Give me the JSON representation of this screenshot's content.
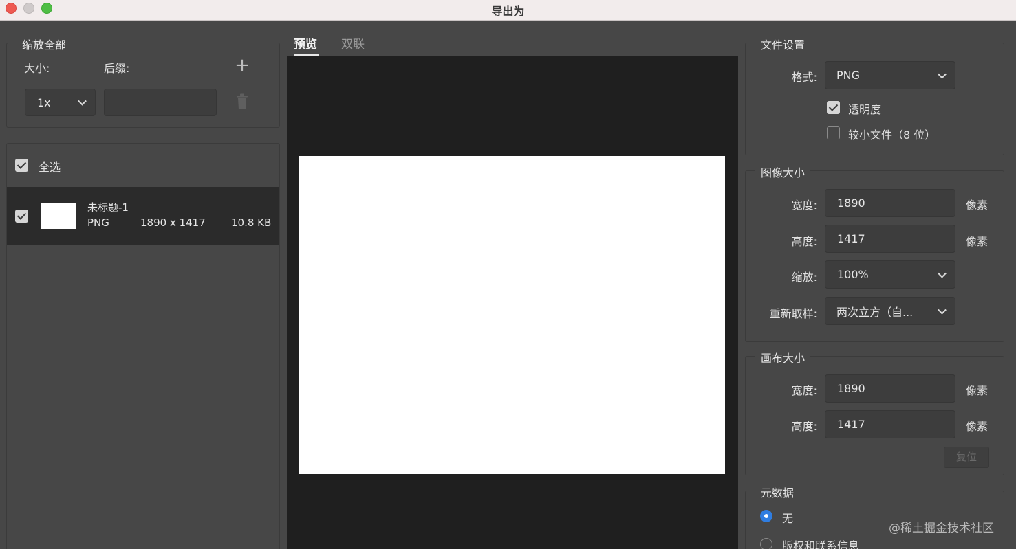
{
  "window": {
    "title": "导出为"
  },
  "scale_all": {
    "legend": "缩放全部",
    "size_label": "大小:",
    "suffix_label": "后缀:",
    "size_value": "1x",
    "suffix_value": "",
    "add_glyph": "+",
    "delete_glyph": "🗑"
  },
  "asset_list": {
    "select_all_label": "全选",
    "select_all_checked": true,
    "items": [
      {
        "name": "未标题-1",
        "format": "PNG",
        "dimensions": "1890 x 1417",
        "size": "10.8 KB",
        "checked": true
      }
    ]
  },
  "preview": {
    "tabs": [
      {
        "label": "预览",
        "active": true
      },
      {
        "label": "双联",
        "active": false
      }
    ],
    "canvas_color": "#ffffff"
  },
  "file_settings": {
    "legend": "文件设置",
    "format_label": "格式:",
    "format_value": "PNG",
    "transparency_label": "透明度",
    "transparency_checked": true,
    "smaller_file_label": "较小文件（8 位）",
    "smaller_file_checked": false
  },
  "image_size": {
    "legend": "图像大小",
    "width_label": "宽度:",
    "width_value": "1890",
    "height_label": "高度:",
    "height_value": "1417",
    "scale_label": "缩放:",
    "scale_value": "100%",
    "resample_label": "重新取样:",
    "resample_value": "两次立方（自...",
    "unit": "像素"
  },
  "canvas_size": {
    "legend": "画布大小",
    "width_label": "宽度:",
    "width_value": "1890",
    "height_label": "高度:",
    "height_value": "1417",
    "unit": "像素",
    "reset_label": "复位"
  },
  "metadata": {
    "legend": "元数据",
    "options": [
      {
        "label": "无",
        "selected": true
      },
      {
        "label": "版权和联系信息",
        "selected": false
      }
    ]
  },
  "watermark": "@稀土掘金技术社区",
  "colors": {
    "accent": "#2f7de1",
    "background": "#474747",
    "dark_panel": "#1f1f1f"
  }
}
